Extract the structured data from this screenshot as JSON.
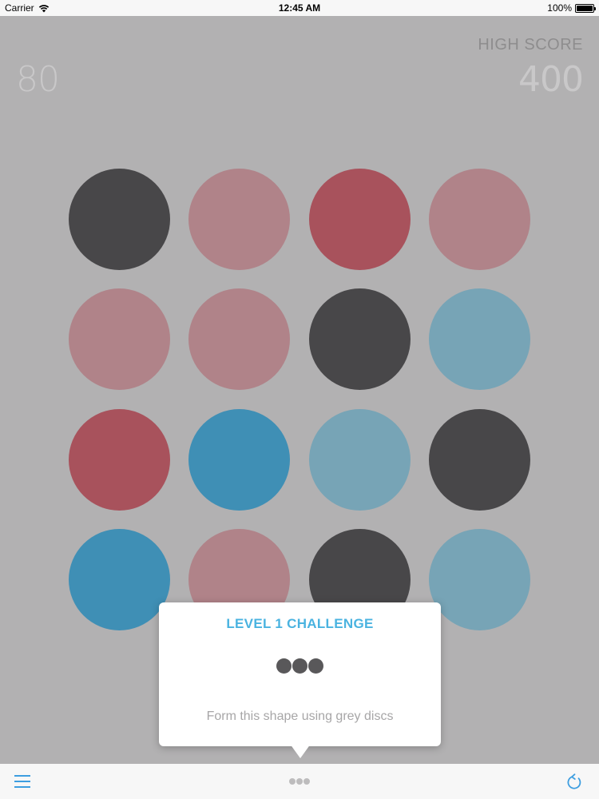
{
  "status_bar": {
    "carrier": "Carrier",
    "time": "12:45 AM",
    "battery": "100%"
  },
  "score": {
    "current": "80",
    "high_score_label": "HIGH SCORE",
    "high_score_value": "400"
  },
  "colors": {
    "grey": "#484749",
    "pink": "#b08389",
    "red": "#a8525c",
    "lightblue": "#77a4b6",
    "blue": "#3f8fb5"
  },
  "board": {
    "rows": [
      [
        "grey",
        "pink",
        "red",
        "pink"
      ],
      [
        "pink",
        "pink",
        "grey",
        "lightblue"
      ],
      [
        "red",
        "blue",
        "lightblue",
        "grey"
      ],
      [
        "blue",
        "pink",
        "grey",
        "lightblue"
      ]
    ]
  },
  "challenge": {
    "title": "LEVEL 1 CHALLENGE",
    "shape": "three grey discs in a row",
    "hint": "Form this shape using grey discs"
  },
  "toolbar": {
    "menu_icon": "menu-icon",
    "refresh_icon": "refresh-icon"
  }
}
